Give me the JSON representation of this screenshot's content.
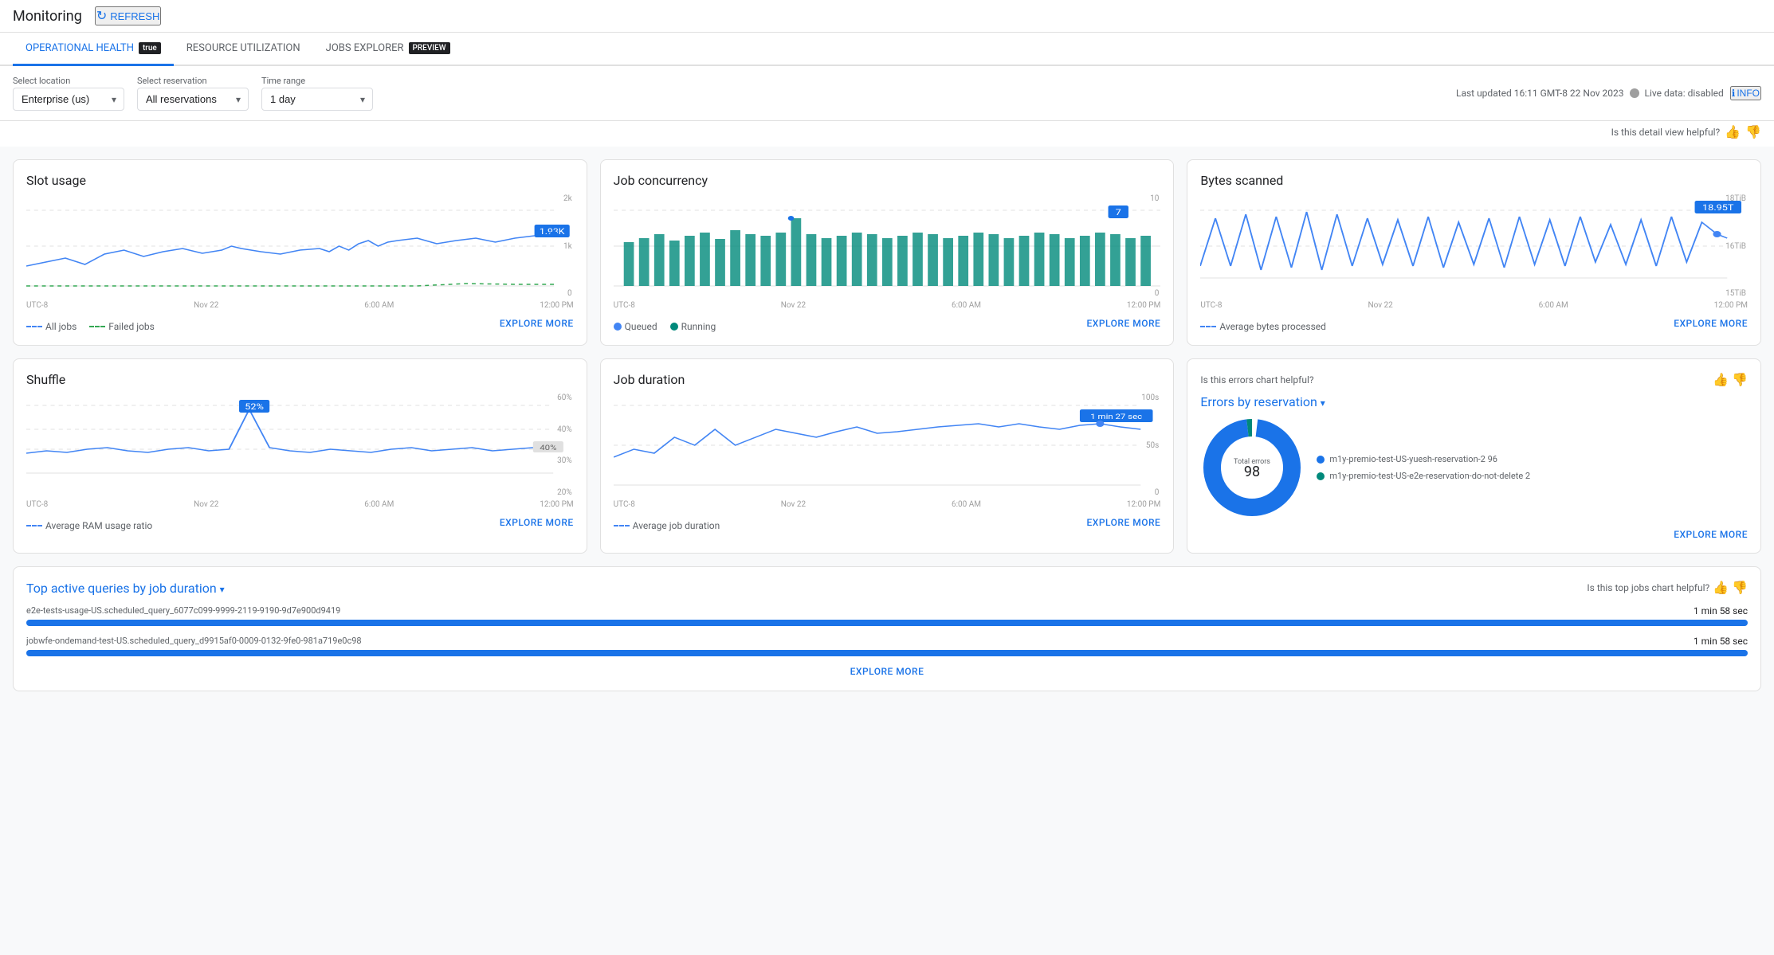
{
  "topbar": {
    "title": "Monitoring",
    "refresh_label": "REFRESH"
  },
  "tabs": [
    {
      "id": "operational-health",
      "label": "OPERATIONAL HEALTH",
      "preview": true,
      "active": true
    },
    {
      "id": "resource-utilization",
      "label": "RESOURCE UTILIZATION",
      "preview": false,
      "active": false
    },
    {
      "id": "jobs-explorer",
      "label": "JOBS EXPLORER",
      "preview": true,
      "active": false
    }
  ],
  "controls": {
    "location_label": "Select location",
    "location_value": "Enterprise (us)",
    "reservation_label": "Select reservation",
    "reservation_value": "All reservations",
    "time_range_label": "Time range",
    "time_range_value": "1 day",
    "last_updated": "Last updated 16:11 GMT-8 22 Nov 2023",
    "live_data_label": "Live data: disabled",
    "info_label": "INFO"
  },
  "helpful_row": {
    "text": "Is this detail view helpful?",
    "thumbup": "👍",
    "thumbdown": "👎"
  },
  "charts": {
    "slot_usage": {
      "title": "Slot usage",
      "y_max": "2k",
      "y_mid": "1k",
      "y_min": "0",
      "x_labels": [
        "UTC-8",
        "Nov 22",
        "6:00 AM",
        "12:00 PM"
      ],
      "legend": [
        {
          "label": "All jobs",
          "type": "dashed",
          "color": "#4285f4"
        },
        {
          "label": "Failed jobs",
          "type": "dashed",
          "color": "#34a853"
        }
      ],
      "value_label": "1.93K",
      "explore_label": "EXPLORE MORE"
    },
    "job_concurrency": {
      "title": "Job concurrency",
      "y_max": "10",
      "y_mid": "",
      "y_min": "0",
      "x_labels": [
        "UTC-8",
        "Nov 22",
        "6:00 AM",
        "12:00 PM"
      ],
      "legend": [
        {
          "label": "Queued",
          "type": "dot",
          "color": "#4285f4"
        },
        {
          "label": "Running",
          "type": "dot",
          "color": "#00897b"
        }
      ],
      "value_label": "7",
      "explore_label": "EXPLORE MORE"
    },
    "bytes_scanned": {
      "title": "Bytes scanned",
      "y_max": "18TiB",
      "y_mid": "16TiB",
      "y_min": "15TiB",
      "x_labels": [
        "UTC-8",
        "Nov 22",
        "6:00 AM",
        "12:00 PM"
      ],
      "legend": [
        {
          "label": "Average bytes processed",
          "type": "dashed",
          "color": "#4285f4"
        }
      ],
      "value_label": "18.95T",
      "explore_label": "EXPLORE MORE"
    },
    "shuffle": {
      "title": "Shuffle",
      "y_max": "60%",
      "y_mid": "40%",
      "y_low": "30%",
      "y_min": "20%",
      "x_labels": [
        "UTC-8",
        "Nov 22",
        "6:00 AM",
        "12:00 PM"
      ],
      "legend": [
        {
          "label": "Average RAM usage ratio",
          "type": "dashed",
          "color": "#4285f4"
        }
      ],
      "value_label": "52%",
      "explore_label": "EXPLORE MORE"
    },
    "job_duration": {
      "title": "Job duration",
      "y_max": "100s",
      "y_mid": "50s",
      "y_min": "0",
      "x_labels": [
        "UTC-8",
        "Nov 22",
        "6:00 AM",
        "12:00 PM"
      ],
      "legend": [
        {
          "label": "Average job duration",
          "type": "dashed",
          "color": "#4285f4"
        }
      ],
      "value_label": "1 min 27 sec",
      "explore_label": "EXPLORE MORE"
    }
  },
  "errors": {
    "helpful_text": "Is this errors chart helpful?",
    "title_prefix": "Errors by ",
    "title_filter": "reservation",
    "total_errors_label": "Total errors",
    "total_errors_value": "98",
    "legend": [
      {
        "label": "m1y-premio-test-US-yuesh-reservation-2 96",
        "color": "#1a73e8"
      },
      {
        "label": "m1y-premio-test-US-e2e-reservation-do-not-delete 2",
        "color": "#00897b"
      }
    ],
    "explore_label": "EXPLORE MORE",
    "donut_main_pct": 98,
    "donut_small_pct": 2
  },
  "top_queries": {
    "helpful_text": "Is this top jobs chart helpful?",
    "title_prefix": "Top active queries by ",
    "title_filter": "job duration",
    "queries": [
      {
        "name": "e2e-tests-usage-US.scheduled_query_6077c099-9999-2119-9190-9d7e900d9419",
        "duration": "1 min 58 sec",
        "bar_pct": 100
      },
      {
        "name": "jobwfe-ondemand-test-US.scheduled_query_d9915af0-0009-0132-9fe0-981a719e0c98",
        "duration": "1 min 58 sec",
        "bar_pct": 100
      }
    ],
    "explore_label": "EXPLORE MORE"
  }
}
